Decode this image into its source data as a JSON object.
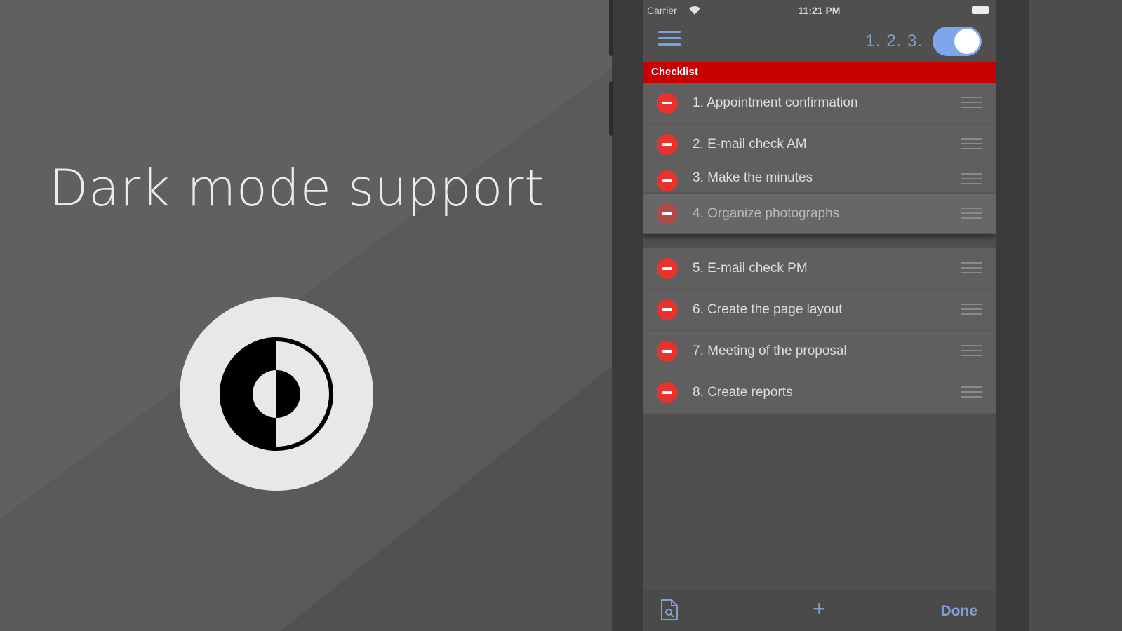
{
  "headline": "Dark mode support",
  "colors": {
    "background": "#555555",
    "accent": "#7f9fd6",
    "section_red": "#c80000",
    "delete_red": "#e8322b",
    "toggle_on": "#7ea6ec"
  },
  "badge_icon": "dark-mode-contrast-icon",
  "status_bar": {
    "carrier": "Carrier",
    "time": "11:21 PM",
    "wifi_icon": "wifi-icon",
    "battery_icon": "battery-icon"
  },
  "nav": {
    "menu_icon": "hamburger-menu-icon",
    "numbering_label": "1. 2. 3.",
    "numbering_toggle_on": true
  },
  "section_title": "Checklist",
  "items": [
    {
      "label": "1. Appointment confirmation"
    },
    {
      "label": "2. E-mail check AM"
    },
    {
      "label": "3. Make the minutes"
    },
    {
      "label": "4. Organize photographs"
    },
    {
      "label": "5. E-mail check PM"
    },
    {
      "label": "6. Create the page layout"
    },
    {
      "label": "7. Meeting of the proposal"
    },
    {
      "label": "8. Create reports"
    }
  ],
  "toolbar": {
    "doc_icon": "document-icon",
    "add_label": "+",
    "done_label": "Done"
  }
}
